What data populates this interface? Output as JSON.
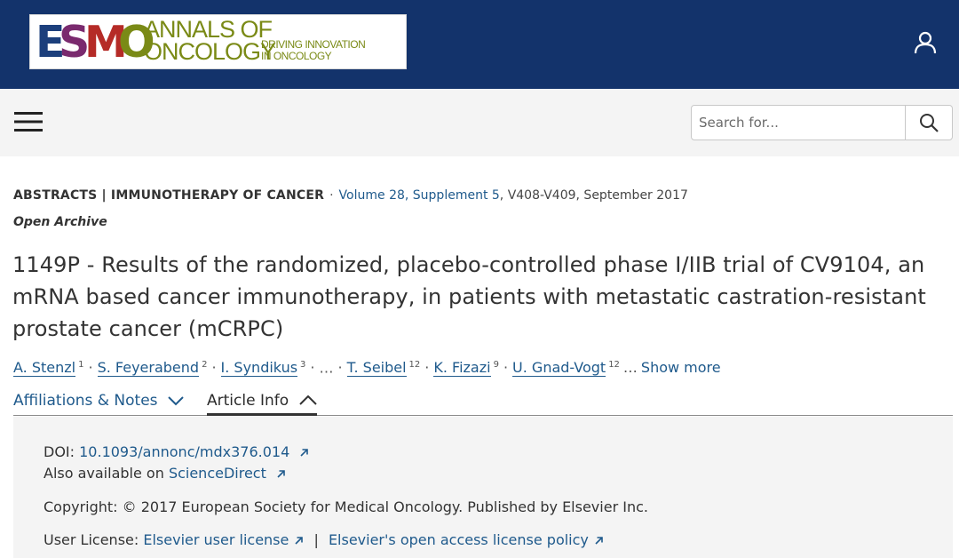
{
  "header": {
    "logo": {
      "esmo_letters": [
        "E",
        "S",
        "M",
        "O"
      ],
      "esmo_colors": [
        "#1c3f7c",
        "#7a2a6e",
        "#b52b27",
        "#7a8a16"
      ],
      "title_lines": [
        "ANNALS OF",
        "ONCOLOGY"
      ],
      "tagline_lines": [
        "DRIVING INNOVATION",
        "IN ONCOLOGY"
      ]
    },
    "user_icon": "user-icon"
  },
  "nav": {
    "menu_icon": "hamburger-menu-icon",
    "search_placeholder": "Search for...",
    "search_icon": "search-icon"
  },
  "article": {
    "section": "ABSTRACTS | IMMUNOTHERAPY OF CANCER",
    "volume_link": "Volume 28, Supplement 5",
    "volume_rest": ", V408-V409, September 2017",
    "access": "Open Archive",
    "title": "1149P - Results of the randomized, placebo-controlled phase I/IIB trial of CV9104, an mRNA based cancer immunotherapy, in patients with metastatic castration-resistant prostate cancer (mCRPC)",
    "authors": [
      {
        "name": "A. Stenzl",
        "sup": "1"
      },
      {
        "name": "S. Feyerabend",
        "sup": "2"
      },
      {
        "name": "I. Syndikus",
        "sup": "3"
      },
      {
        "name": "T. Seibel",
        "sup": "12"
      },
      {
        "name": "K. Fizazi",
        "sup": "9"
      },
      {
        "name": "U. Gnad-Vogt",
        "sup": "12"
      }
    ],
    "ellipsis": "…",
    "show_more": "Show more"
  },
  "tabs": {
    "affiliations": "Affiliations & Notes",
    "article_info": "Article Info"
  },
  "info": {
    "doi_label": "DOI:",
    "doi": "10.1093/annonc/mdx376.014",
    "also_label": "Also available on",
    "also_link": "ScienceDirect",
    "copyright": "Copyright: © 2017 European Society for Medical Oncology. Published by Elsevier Inc.",
    "license_label": "User License:",
    "license_link_1": "Elsevier user license",
    "license_sep": "|",
    "license_link_2": "Elsevier's open access license policy"
  },
  "colors": {
    "header_bg": "#13336b",
    "nav_bg": "#f4f4f4",
    "link": "#1f5a8c",
    "panel_bg": "#f4f4f4"
  }
}
